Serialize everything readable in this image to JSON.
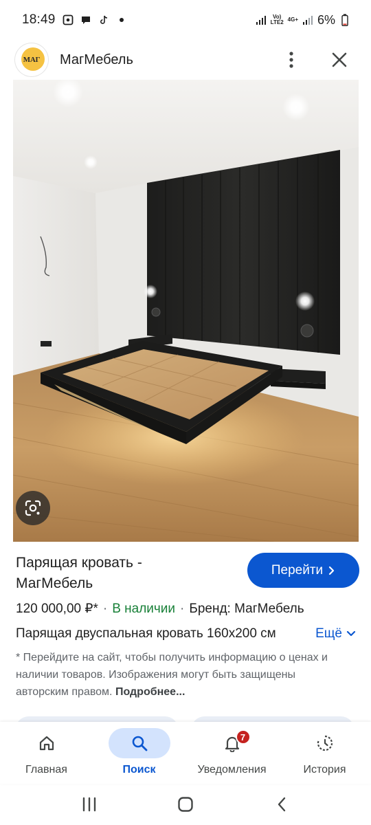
{
  "status_bar": {
    "time": "18:49",
    "network_top": "Vo)",
    "network_bottom": "LTE2",
    "network_type": "4G+",
    "battery": "6%"
  },
  "header": {
    "logo_text": "МАГ",
    "site_name": "МагМебель",
    "menu_icon": "more-vert-icon",
    "close_icon": "close-icon"
  },
  "product": {
    "title": "Парящая кровать - МагМебель",
    "go_label": "Перейти",
    "price": "120 000,00 ₽*",
    "stock": "В наличии",
    "brand": "Бренд: МагМебель",
    "description": "Парящая двуспальная кровать 160х200 см",
    "more_label": "Ещё",
    "notice": "* Перейдите на сайт, чтобы получить информацию о ценах и наличии товаров. Изображения могут быть защищены авторским правом.",
    "notice_more": "Подробнее..."
  },
  "bottom_nav": {
    "items": [
      {
        "label": "Главная",
        "icon": "home-icon"
      },
      {
        "label": "Поиск",
        "icon": "search-icon"
      },
      {
        "label": "Уведомления",
        "icon": "bell-icon",
        "badge": "7"
      },
      {
        "label": "История",
        "icon": "history-icon"
      }
    ]
  },
  "colors": {
    "accent": "#0b57d0",
    "in_stock": "#188038",
    "badge": "#c5221f"
  }
}
